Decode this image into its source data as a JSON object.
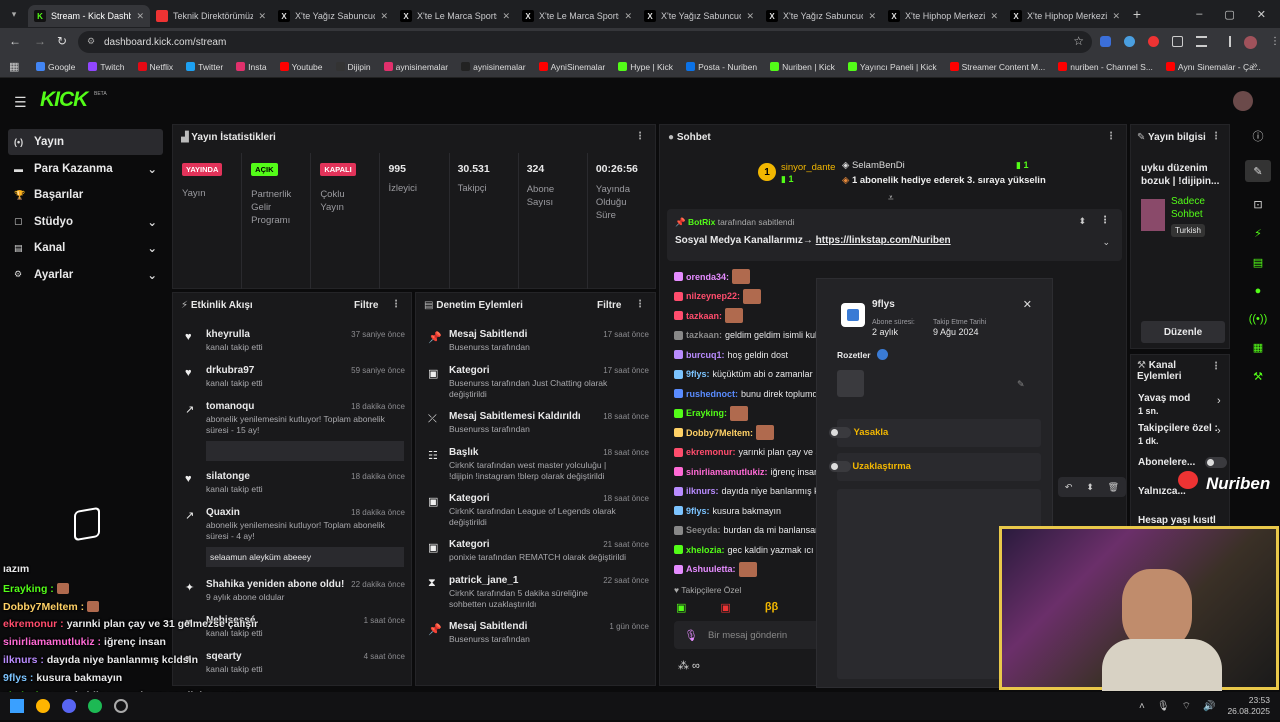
{
  "browser": {
    "tabs": [
      "Stream - Kick Dashbo",
      "Teknik Direktörümüz",
      "X'te Yağız Sabuncuoğ",
      "X'te Le Marca Sports",
      "X'te Le Marca Sports",
      "X'te Yağız Sabuncuoğ",
      "X'te Yağız Sabuncuoğ",
      "X'te Hiphop Merkezi",
      "X'te Hiphop Merkezi"
    ],
    "url": "dashboard.kick.com/stream",
    "bookmarks": [
      "Google",
      "Twitch",
      "Netflix",
      "Twitter",
      "Insta",
      "Youtube",
      "Dijipin",
      "aynisinemalar",
      "aynisinemalar",
      "AyniSinemalar",
      "Hype | Kick",
      "Posta - Nuriben",
      "Nuriben | Kick",
      "Yayıncı Paneli | Kick",
      "Streamer Content M...",
      "nuriben - Channel S...",
      "Aynı Sinemalar - Ça..."
    ]
  },
  "logo": "KICK",
  "logo_beta": "BETA",
  "sidebar": {
    "items": [
      {
        "label": "Yayın"
      },
      {
        "label": "Para Kazanma"
      },
      {
        "label": "Başarılar"
      },
      {
        "label": "Stüdyo"
      },
      {
        "label": "Kanal"
      },
      {
        "label": "Ayarlar"
      }
    ]
  },
  "stats": {
    "title": "Yayın İstatistikleri",
    "b1": "YAYINDA",
    "l1": "Yayın",
    "b2": "AÇIK",
    "l2": "Partnerlik Gelir Programı",
    "b3": "KAPALI",
    "l3": "Çoklu Yayın",
    "v4": "995",
    "l4": "İzleyici",
    "v5": "30.531",
    "l5": "Takipçi",
    "v6": "324",
    "l6": "Abone Sayısı",
    "v7": "00:26:56",
    "l7": "Yayında Olduğu Süre"
  },
  "activity": {
    "title": "Etkinlik Akışı",
    "filter": "Filtre",
    "items": [
      {
        "name": "kheyrulla",
        "sub": "kanalı takip etti",
        "time": "37 saniye önce"
      },
      {
        "name": "drkubra97",
        "sub": "kanalı takip etti",
        "time": "59 saniye önce"
      },
      {
        "name": "tomanoqu",
        "sub": "abonelik yenilemesini kutluyor! Toplam abonelik süresi - 15 ay!",
        "time": "18 dakika önce"
      },
      {
        "name": "silatonge",
        "sub": "kanalı takip etti",
        "time": "18 dakika önce"
      },
      {
        "name": "Quaxin",
        "sub": "abonelik yenilemesini kutluyor! Toplam abonelik süresi - 4 ay!",
        "time": "18 dakika önce",
        "msg": "selaamun aleyküm abeeey"
      },
      {
        "name": "Shahika yeniden abone oldu!",
        "sub": "9 aylık abone oldular",
        "time": "22 dakika önce"
      },
      {
        "name": "Nehisessé",
        "sub": "kanalı takip etti",
        "time": "1 saat önce"
      },
      {
        "name": "sqearty",
        "sub": "kanalı takip etti",
        "time": "4 saat önce"
      }
    ]
  },
  "mod": {
    "title": "Denetim Eylemleri",
    "filter": "Filtre",
    "items": [
      {
        "name": "Mesaj Sabitlendi",
        "sub": "Busenurss tarafından",
        "time": "17 saat önce"
      },
      {
        "name": "Kategori",
        "sub": "Busenurss tarafından Just Chatting olarak değiştirildi",
        "time": "17 saat önce"
      },
      {
        "name": "Mesaj Sabitlemesi Kaldırıldı",
        "sub": "Busenurss tarafından",
        "time": "18 saat önce"
      },
      {
        "name": "Başlık",
        "sub": "CirknK tarafından west master yolculuğu | !dijipin !instagram !blerp olarak değiştirildi",
        "time": "18 saat önce"
      },
      {
        "name": "Kategori",
        "sub": "CirknK tarafından League of Legends olarak değiştirildi",
        "time": "18 saat önce"
      },
      {
        "name": "Kategori",
        "sub": "ponixie tarafından REMATCH olarak değiştirildi",
        "time": "21 saat önce"
      },
      {
        "name": "patrick_jane_1",
        "sub": "CirknK tarafından 5 dakika süreliğine sohbetten uzaklaştırıldı",
        "time": "22 saat önce"
      },
      {
        "name": "Mesaj Sabitlendi",
        "sub": "Busenurss tarafından",
        "time": "1 gün önce"
      }
    ]
  },
  "chat": {
    "title": "Sohbet",
    "top_user": "sinyor_dante",
    "top_rank": "1",
    "top_count": "1",
    "gift_user": "SelamBenDi",
    "gift_count": "1",
    "gift_text": "1 abonelik hediye ederek 3. sıraya yükselin",
    "pinned_by": "BotRix",
    "pinned_suffix": "tarafından sabitlendi",
    "pinned_text": "Sosyal Medya Kanallarımız→",
    "pinned_link": "https://linkstap.com/Nuriben",
    "messages": [
      {
        "user": "orenda34:",
        "text": "",
        "color": "#e58cff"
      },
      {
        "user": "nilzeynep22:",
        "text": "",
        "color": "#ff4d6d"
      },
      {
        "user": "tazkaan:",
        "text": "",
        "color": "#ff4d6d"
      },
      {
        "user": "tazkaan:",
        "text": "geldim geldim isimli kullan",
        "color": "#888"
      },
      {
        "user": "burcuq1:",
        "text": "hoş geldin dost",
        "color": "#b98cff"
      },
      {
        "user": "9flys:",
        "text": "küçüktüm abi o zamanlar",
        "color": "#7cc4ff"
      },
      {
        "user": "rushednoct:",
        "text": "bunu direk toplumdan",
        "color": "#5a8cff"
      },
      {
        "user": "Erayking:",
        "text": "",
        "color": "#53fc18"
      },
      {
        "user": "Dobby7Meltem:",
        "text": "",
        "color": "#ffd166"
      },
      {
        "user": "ekremonur:",
        "text": "yarınki plan çay ve 31 g",
        "color": "#ff4d6d"
      },
      {
        "user": "sinirliamamutlukiz:",
        "text": "iğrenç insan",
        "color": "#ff6ad5"
      },
      {
        "user": "ilknurs:",
        "text": "dayıda niye banlanmış kcld",
        "color": "#b98cff"
      },
      {
        "user": "9flys:",
        "text": "kusura bakmayın",
        "color": "#7cc4ff"
      },
      {
        "user": "Seeyda:",
        "text": "burdan da mi banlansan b",
        "color": "#888"
      },
      {
        "user": "xhelozia:",
        "text": "gec kaldin yazmak ıcı",
        "color": "#53fc18"
      },
      {
        "user": "Ashuuletta:",
        "text": "",
        "color": "#e58cff"
      }
    ],
    "followers_only": "Takipçilere Özel",
    "placeholder": "Bir mesaj gönderin"
  },
  "popup": {
    "user": "9flys",
    "sub_label": "Abone süresi:",
    "sub_val": "2 aylık",
    "follow_label": "Takip Etme Tarihi",
    "follow_val": "9 Ağu 2024",
    "badges": "Rozetler",
    "ban": "Yasakla",
    "timeout": "Uzaklaştırma"
  },
  "info": {
    "title": "Yayın bilgisi",
    "stream_title": "uyku düzenim bozuk | !dijipin...",
    "category": "Sadece Sohbet",
    "language": "Turkish",
    "edit": "Düzenle"
  },
  "channel": {
    "title": "Kanal Eylemleri",
    "slow": "Yavaş mod",
    "slow_val": "1 sn.",
    "followers": "Takipçilere özel :",
    "followers_val": "1 dk.",
    "subs": "Abonelere...",
    "emotes": "Yalnızca...",
    "age": "Hesap yaşı kısıtl"
  },
  "overlay": {
    "first": "ıazım",
    "lines": [
      {
        "user": "Erayking :",
        "text": "",
        "color": "#53fc18"
      },
      {
        "user": "Dobby7Meltem :",
        "text": "",
        "color": "#ffd166"
      },
      {
        "user": "ekremonur :",
        "text": "yarınki plan çay ve 31 gelmezse çalışır",
        "color": "#ff4d6d"
      },
      {
        "user": "sinirliamamutlukiz :",
        "text": "iğrenç insan",
        "color": "#ff6ad5"
      },
      {
        "user": "ilknurs :",
        "text": "dayıda niye banlanmış kcldsin",
        "color": "#b98cff"
      },
      {
        "user": "9flys :",
        "text": "kusura bakmayın",
        "color": "#7cc4ff"
      },
      {
        "user": "xhelozia :",
        "text": "gec kaldin yazmak ıcın yaslisin sanırım",
        "color": "#53fc18"
      },
      {
        "user": "Ashuuletta :",
        "text": "",
        "color": "#e58cff"
      }
    ],
    "brand": "Nuriben"
  },
  "taskbar": {
    "time": "23:53",
    "date": "26.08.2025"
  }
}
